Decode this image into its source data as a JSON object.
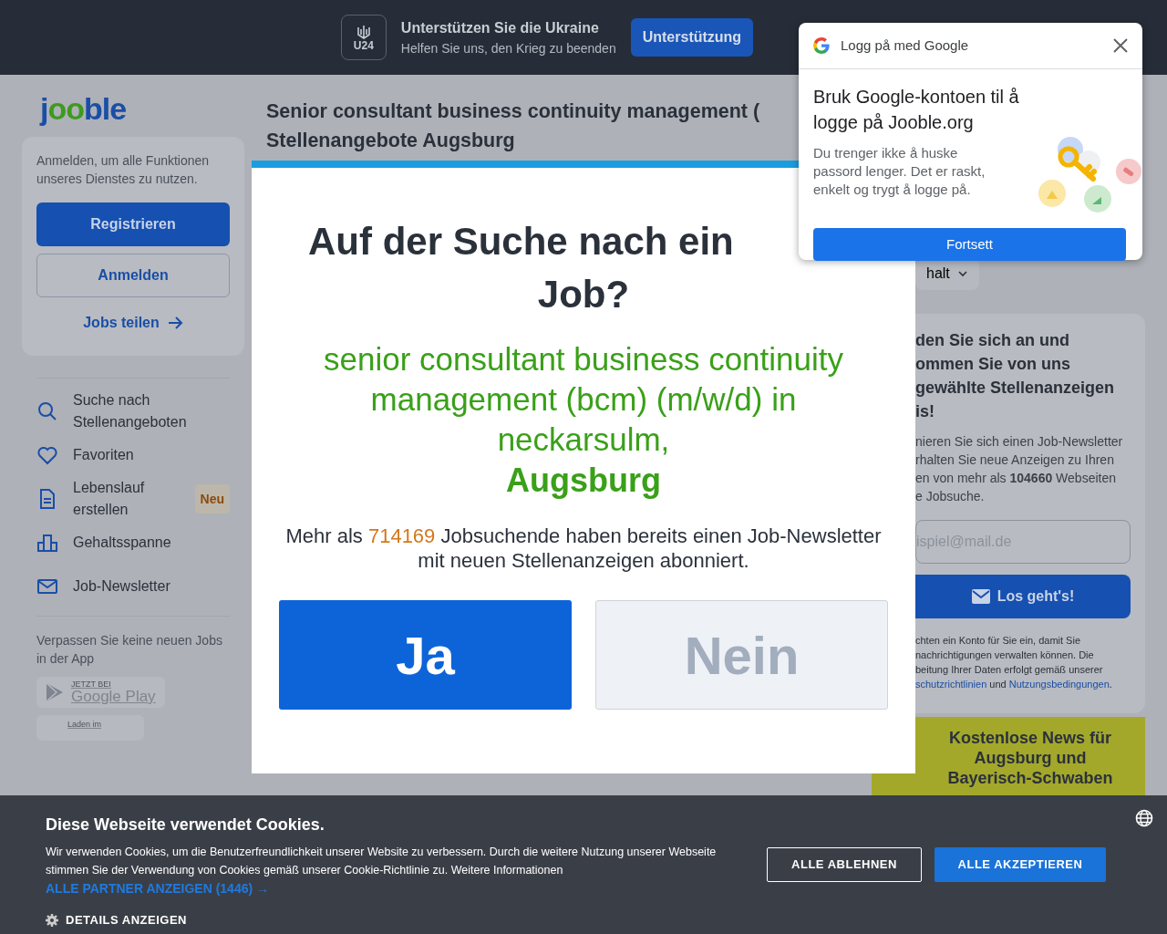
{
  "top_banner": {
    "badge": "U24",
    "title": "Unterstützen Sie die Ukraine",
    "subtitle": "Helfen Sie uns, den Krieg zu beenden",
    "button": "Unterstützung"
  },
  "logo": "jooble",
  "sidebar": {
    "login_hint": "Anmelden, um alle Funktionen unseres Dienstes zu nutzen.",
    "register_button": "Registrieren",
    "login_button": "Anmelden",
    "share_link": "Jobs teilen",
    "items": [
      {
        "label": "Suche nach Stellenangeboten"
      },
      {
        "label": "Favoriten"
      },
      {
        "label": "Lebenslauf erstellen",
        "badge": "Neu"
      },
      {
        "label": "Gehaltsspanne"
      },
      {
        "label": "Job-Newsletter"
      }
    ],
    "app_hint": "Verpassen Sie keine neuen Jobs in der App",
    "google_play": {
      "small": "JETZT BEI",
      "big": "Google Play"
    },
    "app_store": {
      "small": "Laden im"
    }
  },
  "page_title": "Senior consultant business continuity management (",
  "page_subtitle": "Stellenangebote Augsburg",
  "right_column": {
    "dropdown": "halt",
    "heading_lines": [
      "den Sie sich an und",
      "ommen Sie von uns",
      "gewählte Stellenanzeigen",
      "is!"
    ],
    "text_lines": [
      "nieren Sie sich einen Job-Newsletter",
      "rhalten Sie neue Anzeigen zu Ihren",
      "en von mehr als **104660** Webseiten",
      "e Jobsuche."
    ],
    "email_placeholder": "ispiel@mail.de",
    "submit_button": "Los geht's!",
    "terms_lines": [
      "chten ein Konto für Sie ein, damit Sie",
      "nachrichtigungen verwalten können. Die",
      "beitung Ihrer Daten erfolgt gemäß unserer"
    ],
    "terms_link_1": "schutzrichtlinien",
    "terms_and": "und",
    "terms_link_2": "Nutzungsbedingungen",
    "terms_end": ".",
    "news_lines": [
      "Kostenlose News für",
      "Augsburg und",
      "Bayerisch-Schwaben"
    ]
  },
  "modal": {
    "heading_lines": [
      "Auf der Suche nach ein",
      "Job?"
    ],
    "query": "senior consultant business continuity management (bcm) (m/w/d) in neckarsulm,",
    "location": "Augsburg",
    "text_before": "Mehr als",
    "count": "714169",
    "text_after": "Jobsuchende haben bereits einen Job-Newsletter mit neuen Stellenanzeigen abonniert.",
    "yes_button": "Ja",
    "no_button": "Nein"
  },
  "google_popup": {
    "header": "Logg på med Google",
    "title": "Bruk Google-kontoen til å logge på Jooble.org",
    "text": "Du trenger ikke å huske passord lenger. Det er raskt, enkelt og trygt å logge på.",
    "button": "Fortsett"
  },
  "cookie_bar": {
    "title": "Diese Webseite verwendet Cookies.",
    "text": "Wir verwenden Cookies, um die Benutzerfreundlichkeit unserer Website zu verbessern. Durch die weitere Nutzung unserer Webseite stimmen Sie der Verwendung von Cookies gemäß unserer Cookie-Richtlinie zu. Weitere Informationen",
    "partners_link": "ALLE PARTNER ANZEIGEN (1446) →",
    "details": "DETAILS ANZEIGEN",
    "reject_button": "ALLE ABLEHNEN",
    "accept_button": "ALLE AKZEPTIEREN"
  }
}
